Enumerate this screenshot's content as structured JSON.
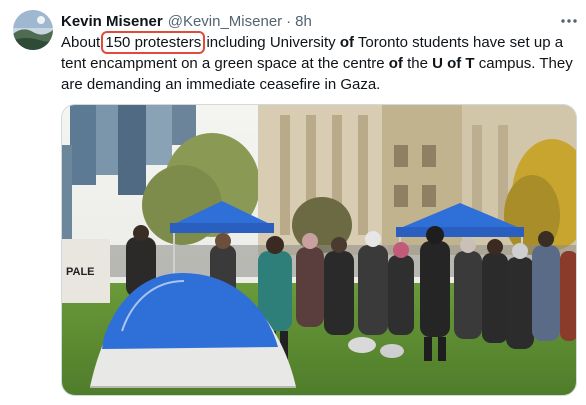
{
  "tweet": {
    "author_name": "Kevin Misener",
    "author_handle": "@Kevin_Misener",
    "separator": "·",
    "timestamp": "8h",
    "text_parts": [
      "About",
      "150 protesters",
      "including University",
      "of",
      "Toronto students have set up a",
      "tent encampment on a green space at the centre",
      "of",
      "the",
      "U of T",
      "campus.  They",
      "are demanding an immediate ceasefire in Gaza."
    ],
    "highlighted_phrase_color": "#e04b3a"
  },
  "icons": {
    "more": "more-options-icon",
    "avatar": "profile-avatar"
  },
  "media": {
    "description_visible": "photo",
    "sign_text": "PALE"
  },
  "colors": {
    "text_primary": "#0f1419",
    "text_secondary": "#536471",
    "tent_blue": "#2f6fd8",
    "grass": "#5e8a34"
  }
}
